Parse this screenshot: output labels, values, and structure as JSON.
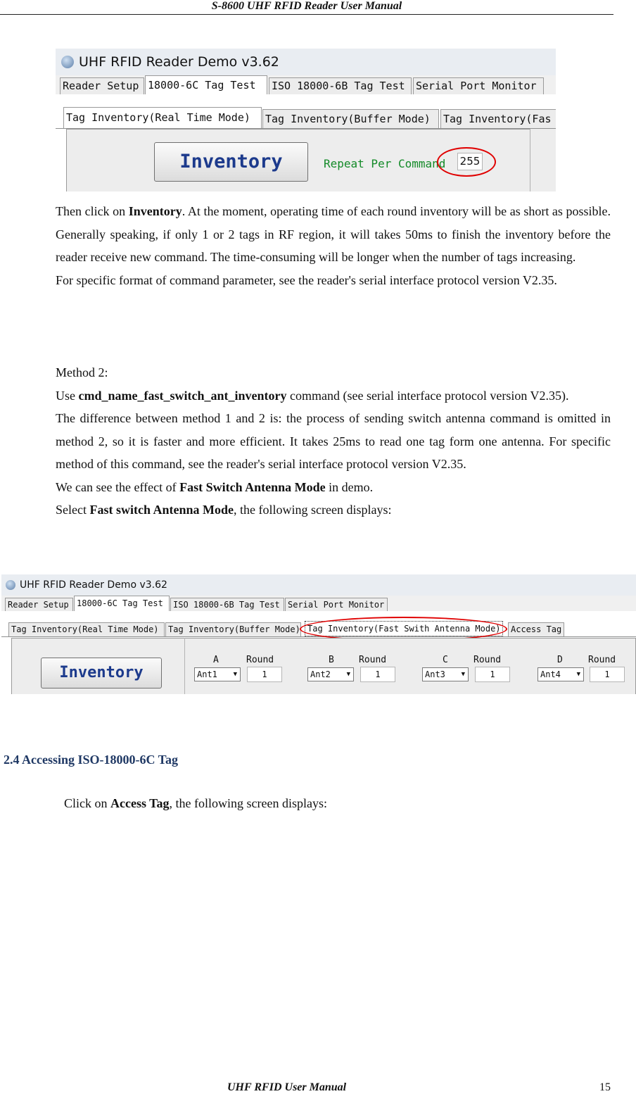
{
  "header": "S-8600 UHF RFID Reader User Manual",
  "shot1": {
    "title": "UHF RFID Reader Demo v3.62",
    "tabs": [
      "Reader Setup",
      "18000-6C Tag Test",
      "ISO 18000-6B Tag Test",
      "Serial Port Monitor"
    ],
    "subtabs": [
      "Tag Inventory(Real Time Mode)",
      "Tag Inventory(Buffer Mode)",
      "Tag Inventory(Fas"
    ],
    "inventory_button": "Inventory",
    "repeat_label": "Repeat Per Command",
    "repeat_value": "255"
  },
  "para1": {
    "p1_a": "Then click on ",
    "p1_b": "Inventory",
    "p1_c": ". At the moment, operating time of each round inventory will be as short as possible. Generally speaking, if only 1 or 2 tags in RF region, it will takes 50ms to finish the inventory before the reader receive new command. The time-consuming will be longer when the number of tags increasing.",
    "p2": "For specific format of command parameter, see the reader's serial interface protocol version V2.35."
  },
  "para2": {
    "method": "Method 2:",
    "use_a": "Use ",
    "use_b": "cmd_name_fast_switch_ant_inventory",
    "use_c": " command (see serial interface protocol version V2.35).",
    "diff": "The difference between method 1 and 2 is: the process of sending switch antenna command is omitted in method 2, so it is faster and more efficient. It takes 25ms to read one tag form one antenna. For specific method of this command, see the reader's serial interface protocol version V2.35.",
    "effect_a": "We can see the effect of ",
    "effect_b": "Fast Switch Antenna Mode",
    "effect_c": " in demo.",
    "select_a": "Select ",
    "select_b": "Fast switch Antenna Mode",
    "select_c": ", the following screen displays:"
  },
  "shot2": {
    "title": "UHF RFID Reader Demo v3.62",
    "tabs": [
      "Reader Setup",
      "18000-6C Tag Test",
      "ISO 18000-6B Tag Test",
      "Serial Port Monitor"
    ],
    "subtabs": [
      "Tag Inventory(Real Time Mode)",
      "Tag Inventory(Buffer Mode)",
      "Tag Inventory(Fast Swith Antenna Mode)",
      "Access Tag"
    ],
    "inventory_button": "Inventory",
    "antennas": [
      {
        "letter": "A",
        "round_label": "Round",
        "ant": "Ant1",
        "round": "1"
      },
      {
        "letter": "B",
        "round_label": "Round",
        "ant": "Ant2",
        "round": "1"
      },
      {
        "letter": "C",
        "round_label": "Round",
        "ant": "Ant3",
        "round": "1"
      },
      {
        "letter": "D",
        "round_label": "Round",
        "ant": "Ant4",
        "round": "1"
      }
    ]
  },
  "section_heading": "2.4 Accessing ISO-18000-6C Tag",
  "click": {
    "a": "Click on ",
    "b": "Access Tag",
    "c": ", the following screen displays:"
  },
  "footer": {
    "title": "UHF RFID User Manual",
    "page": "15"
  }
}
